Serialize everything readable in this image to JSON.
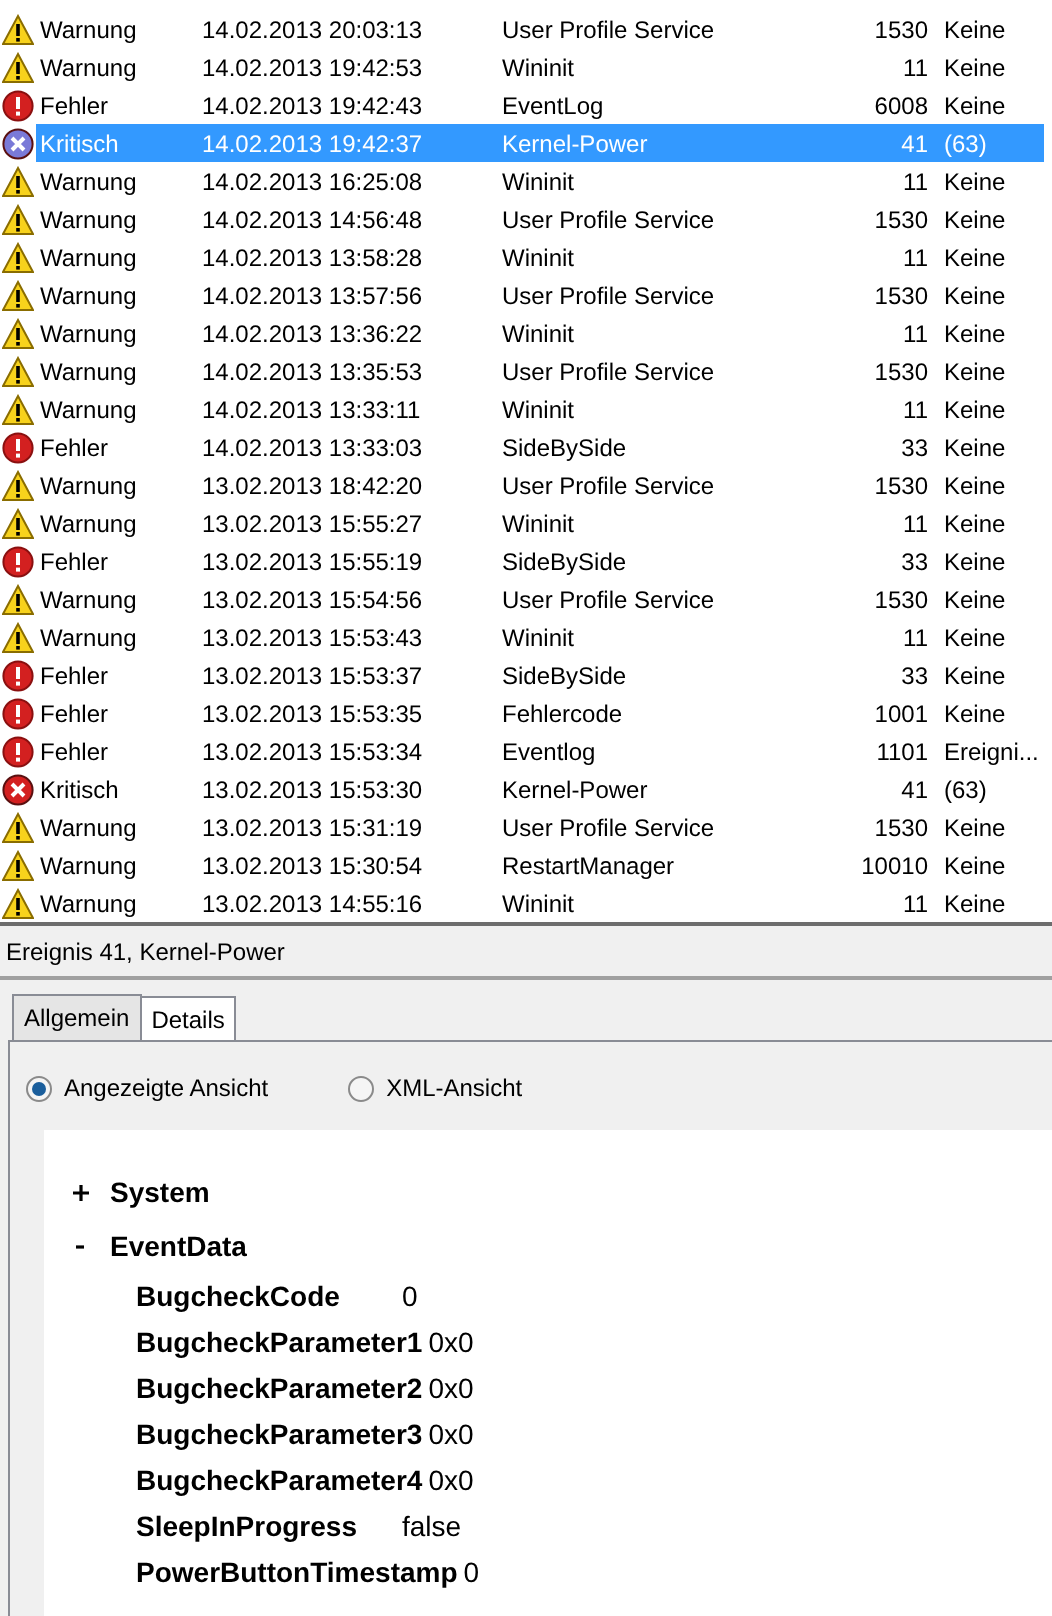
{
  "events": [
    {
      "kind": "warning",
      "level": "Warnung",
      "date": "14.02.2013 20:03:13",
      "source": "User Profile Service",
      "id": "1530",
      "task": "Keine",
      "selected": false
    },
    {
      "kind": "warning",
      "level": "Warnung",
      "date": "14.02.2013 19:42:53",
      "source": "Wininit",
      "id": "11",
      "task": "Keine",
      "selected": false
    },
    {
      "kind": "error",
      "level": "Fehler",
      "date": "14.02.2013 19:42:43",
      "source": "EventLog",
      "id": "6008",
      "task": "Keine",
      "selected": false
    },
    {
      "kind": "critical",
      "level": "Kritisch",
      "date": "14.02.2013 19:42:37",
      "source": "Kernel-Power",
      "id": "41",
      "task": "(63)",
      "selected": true
    },
    {
      "kind": "warning",
      "level": "Warnung",
      "date": "14.02.2013 16:25:08",
      "source": "Wininit",
      "id": "11",
      "task": "Keine",
      "selected": false
    },
    {
      "kind": "warning",
      "level": "Warnung",
      "date": "14.02.2013 14:56:48",
      "source": "User Profile Service",
      "id": "1530",
      "task": "Keine",
      "selected": false
    },
    {
      "kind": "warning",
      "level": "Warnung",
      "date": "14.02.2013 13:58:28",
      "source": "Wininit",
      "id": "11",
      "task": "Keine",
      "selected": false
    },
    {
      "kind": "warning",
      "level": "Warnung",
      "date": "14.02.2013 13:57:56",
      "source": "User Profile Service",
      "id": "1530",
      "task": "Keine",
      "selected": false
    },
    {
      "kind": "warning",
      "level": "Warnung",
      "date": "14.02.2013 13:36:22",
      "source": "Wininit",
      "id": "11",
      "task": "Keine",
      "selected": false
    },
    {
      "kind": "warning",
      "level": "Warnung",
      "date": "14.02.2013 13:35:53",
      "source": "User Profile Service",
      "id": "1530",
      "task": "Keine",
      "selected": false
    },
    {
      "kind": "warning",
      "level": "Warnung",
      "date": "14.02.2013 13:33:11",
      "source": "Wininit",
      "id": "11",
      "task": "Keine",
      "selected": false
    },
    {
      "kind": "error",
      "level": "Fehler",
      "date": "14.02.2013 13:33:03",
      "source": "SideBySide",
      "id": "33",
      "task": "Keine",
      "selected": false
    },
    {
      "kind": "warning",
      "level": "Warnung",
      "date": "13.02.2013 18:42:20",
      "source": "User Profile Service",
      "id": "1530",
      "task": "Keine",
      "selected": false
    },
    {
      "kind": "warning",
      "level": "Warnung",
      "date": "13.02.2013 15:55:27",
      "source": "Wininit",
      "id": "11",
      "task": "Keine",
      "selected": false
    },
    {
      "kind": "error",
      "level": "Fehler",
      "date": "13.02.2013 15:55:19",
      "source": "SideBySide",
      "id": "33",
      "task": "Keine",
      "selected": false
    },
    {
      "kind": "warning",
      "level": "Warnung",
      "date": "13.02.2013 15:54:56",
      "source": "User Profile Service",
      "id": "1530",
      "task": "Keine",
      "selected": false
    },
    {
      "kind": "warning",
      "level": "Warnung",
      "date": "13.02.2013 15:53:43",
      "source": "Wininit",
      "id": "11",
      "task": "Keine",
      "selected": false
    },
    {
      "kind": "error",
      "level": "Fehler",
      "date": "13.02.2013 15:53:37",
      "source": "SideBySide",
      "id": "33",
      "task": "Keine",
      "selected": false
    },
    {
      "kind": "error",
      "level": "Fehler",
      "date": "13.02.2013 15:53:35",
      "source": "Fehlercode",
      "id": "1001",
      "task": "Keine",
      "selected": false
    },
    {
      "kind": "error",
      "level": "Fehler",
      "date": "13.02.2013 15:53:34",
      "source": "Eventlog",
      "id": "1101",
      "task": "Ereigni...",
      "selected": false
    },
    {
      "kind": "critical",
      "level": "Kritisch",
      "date": "13.02.2013 15:53:30",
      "source": "Kernel-Power",
      "id": "41",
      "task": "(63)",
      "selected": false
    },
    {
      "kind": "warning",
      "level": "Warnung",
      "date": "13.02.2013 15:31:19",
      "source": "User Profile Service",
      "id": "1530",
      "task": "Keine",
      "selected": false
    },
    {
      "kind": "warning",
      "level": "Warnung",
      "date": "13.02.2013 15:30:54",
      "source": "RestartManager",
      "id": "10010",
      "task": "Keine",
      "selected": false
    },
    {
      "kind": "warning",
      "level": "Warnung",
      "date": "13.02.2013 14:55:16",
      "source": "Wininit",
      "id": "11",
      "task": "Keine",
      "selected": false
    }
  ],
  "details": {
    "title": "Ereignis 41, Kernel-Power",
    "tabs": [
      {
        "label": "Allgemein",
        "selected": false
      },
      {
        "label": "Details",
        "selected": true
      }
    ],
    "views": [
      {
        "label": "Angezeigte Ansicht",
        "selected": true
      },
      {
        "label": "XML-Ansicht",
        "selected": false
      }
    ],
    "tree": [
      {
        "label": "System",
        "expanded": false
      },
      {
        "label": "EventData",
        "expanded": true,
        "children": [
          {
            "name": "BugcheckCode",
            "value": "0"
          },
          {
            "name": "BugcheckParameter1",
            "value": "0x0"
          },
          {
            "name": "BugcheckParameter2",
            "value": "0x0"
          },
          {
            "name": "BugcheckParameter3",
            "value": "0x0"
          },
          {
            "name": "BugcheckParameter4",
            "value": "0x0"
          },
          {
            "name": "SleepInProgress",
            "value": "false"
          },
          {
            "name": "PowerButtonTimestamp",
            "value": "0"
          }
        ]
      }
    ]
  }
}
